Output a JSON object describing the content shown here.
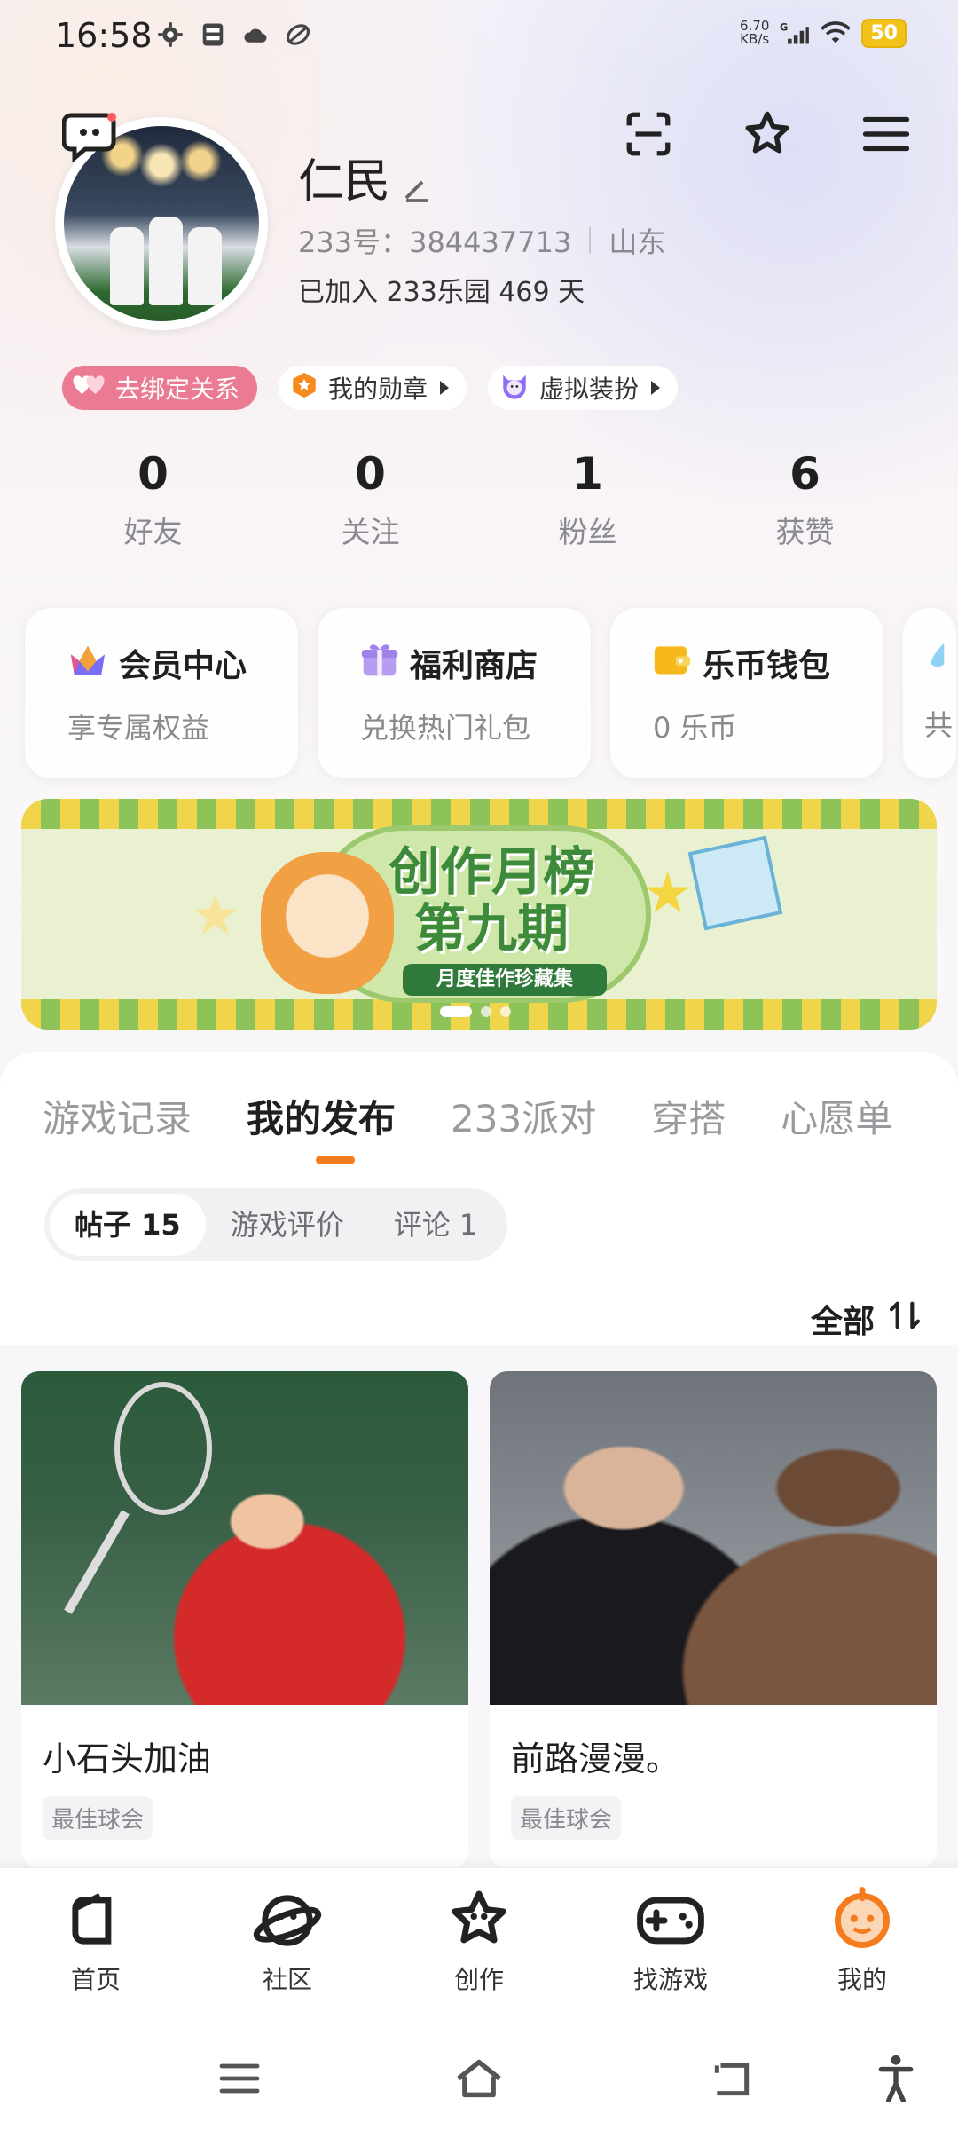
{
  "status_bar": {
    "time": "16:58",
    "net_speed_value": "6.70",
    "net_speed_unit": "KB/s",
    "signal_label": "G",
    "battery": "50"
  },
  "profile": {
    "username": "仁民",
    "uid": "233号：384437713",
    "location": "山东",
    "joined": "已加入 233乐园 469 天"
  },
  "badges": [
    {
      "label": "去绑定关系"
    },
    {
      "label": "我的勋章"
    },
    {
      "label": "虚拟装扮"
    }
  ],
  "stats": [
    {
      "value": "0",
      "label": "好友"
    },
    {
      "value": "0",
      "label": "关注"
    },
    {
      "value": "1",
      "label": "粉丝"
    },
    {
      "value": "6",
      "label": "获赞"
    }
  ],
  "cards": [
    {
      "title": "会员中心",
      "sub": "享专属权益"
    },
    {
      "title": "福利商店",
      "sub": "兑换热门礼包"
    },
    {
      "title": "乐币钱包",
      "sub": "0 乐币"
    },
    {
      "title": "",
      "sub": "共"
    }
  ],
  "banner": {
    "title_line1": "创作月榜",
    "title_line2": "第九期",
    "subtitle": "月度佳作珍藏集"
  },
  "tabs": [
    "游戏记录",
    "我的发布",
    "233派对",
    "穿搭",
    "心愿单"
  ],
  "subtabs": [
    "帖子 15",
    "游戏评价",
    "评论 1"
  ],
  "sort_label": "全部",
  "posts": [
    {
      "title": "小石头加油",
      "tag": "最佳球会"
    },
    {
      "title": "前路漫漫。",
      "tag": "最佳球会"
    }
  ],
  "bottom_nav": [
    {
      "label": "首页",
      "icon": "home-icon"
    },
    {
      "label": "社区",
      "icon": "planet-icon"
    },
    {
      "label": "创作",
      "icon": "star-creature-icon"
    },
    {
      "label": "找游戏",
      "icon": "gamepad-icon"
    },
    {
      "label": "我的",
      "icon": "profile-face-icon"
    }
  ],
  "colors": {
    "accent_orange": "#f57b1f",
    "pink_badge": "#ea7b93",
    "battery_yellow": "#f2c21b"
  }
}
